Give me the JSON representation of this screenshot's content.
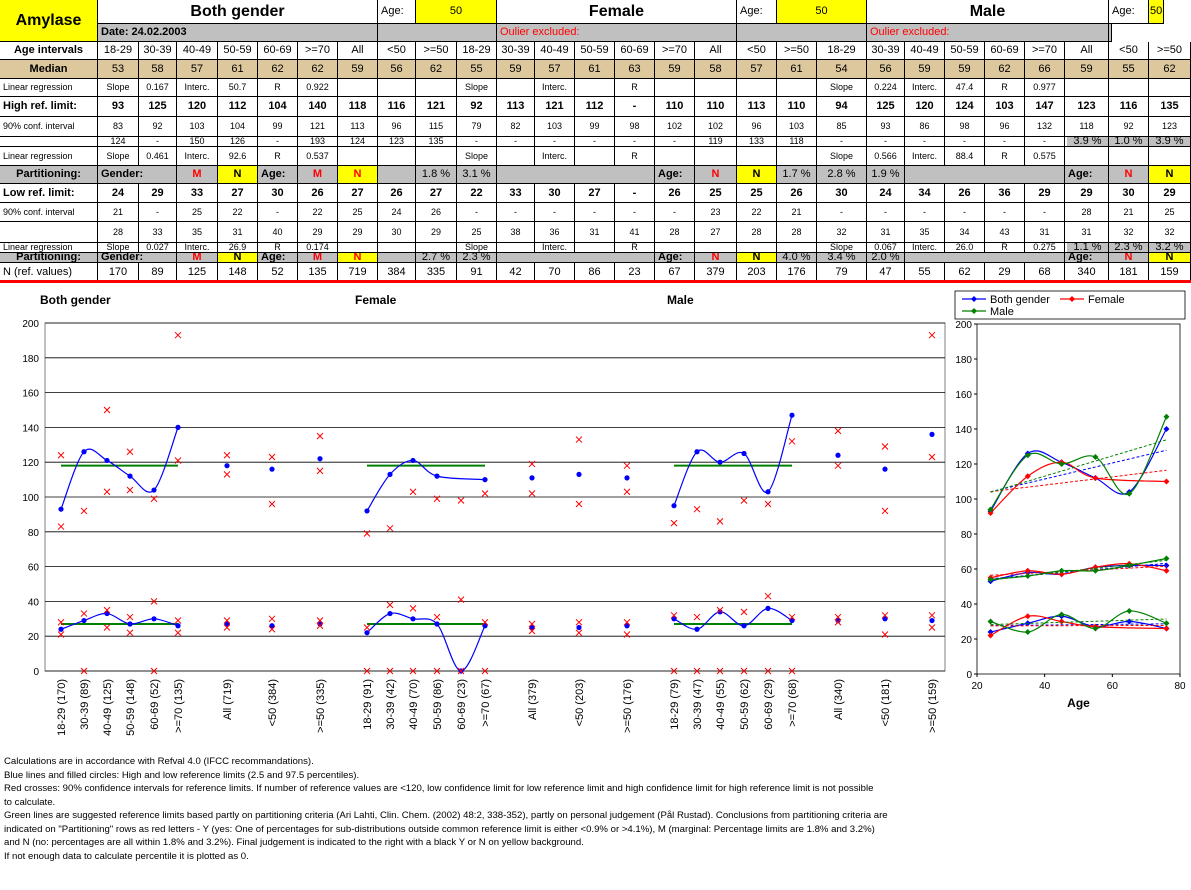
{
  "title": "Amylase",
  "date": "Date: 24.02.2003",
  "groups": {
    "both": "Both gender",
    "female": "Female",
    "male": "Male"
  },
  "age_label": "Age:",
  "age_value": "50",
  "outlier_note": "Oulier excluded:",
  "age_intervals_label": "Age intervals",
  "col_labels": [
    "18-29",
    "30-39",
    "40-49",
    "50-59",
    "60-69",
    ">=70",
    "All",
    "<50",
    ">=50"
  ],
  "rows": {
    "median": {
      "label": "Median",
      "both": [
        "53",
        "58",
        "57",
        "61",
        "62",
        "62",
        "59",
        "56",
        "62"
      ],
      "female": [
        "55",
        "59",
        "57",
        "61",
        "63",
        "59",
        "58",
        "57",
        "61"
      ],
      "male": [
        "54",
        "56",
        "59",
        "59",
        "62",
        "66",
        "59",
        "55",
        "62"
      ]
    },
    "linreg_top": {
      "label": "Linear regression",
      "both": [
        "Slope",
        "0.167",
        "Interc.",
        "50.7",
        "R",
        "0.922",
        "",
        "",
        ""
      ],
      "female": [
        "Slope",
        "",
        "Interc.",
        "",
        "R",
        "",
        "",
        "",
        ""
      ],
      "male": [
        "Slope",
        "0.224",
        "Interc.",
        "47.4",
        "R",
        "0.977",
        "",
        "",
        ""
      ]
    },
    "high": {
      "label": "High ref. limit:",
      "both": [
        "93",
        "125",
        "120",
        "112",
        "104",
        "140",
        "118",
        "116",
        "121"
      ],
      "female": [
        "92",
        "113",
        "121",
        "112",
        "-",
        "110",
        "110",
        "113",
        "110"
      ],
      "male": [
        "94",
        "125",
        "120",
        "124",
        "103",
        "147",
        "123",
        "116",
        "135"
      ]
    },
    "hci1": {
      "label": "90% conf. interval",
      "both": [
        "83",
        "92",
        "103",
        "104",
        "99",
        "121",
        "113",
        "96",
        "115"
      ],
      "female": [
        "79",
        "82",
        "103",
        "99",
        "98",
        "102",
        "102",
        "96",
        "103"
      ],
      "male": [
        "85",
        "93",
        "86",
        "98",
        "96",
        "132",
        "118",
        "92",
        "123"
      ]
    },
    "hci2": {
      "both": [
        "124",
        "-",
        "150",
        "126",
        "-",
        "193",
        "124",
        "123",
        "135"
      ],
      "female": [
        "-",
        "-",
        "-",
        "-",
        "-",
        "-",
        "119",
        "133",
        "118"
      ],
      "male": [
        "-",
        "-",
        "-",
        "-",
        "-",
        "-",
        "138",
        "129",
        "193"
      ]
    },
    "linreg_high": {
      "label": "Linear regression",
      "both": [
        "Slope",
        "0.461",
        "Interc.",
        "92.6",
        "R",
        "0.537",
        "",
        "",
        ""
      ],
      "female": [
        "Slope",
        "",
        "Interc.",
        "",
        "R",
        "",
        "",
        "",
        ""
      ],
      "male": [
        "Slope",
        "0.566",
        "Interc.",
        "88.4",
        "R",
        "0.575",
        "",
        "",
        ""
      ]
    },
    "part1": {
      "label": "Partitioning:",
      "gender": "Gender:",
      "gender_val": "M",
      "n": "N",
      "age": "Age:",
      "age_val": "M",
      "age_n": "N",
      "both_pct": [
        "1.8 %",
        "3.1 %"
      ],
      "female_pct": [
        "1.7 %",
        "2.8 %",
        "1.9 %"
      ],
      "female_n": "N",
      "male_n1": "N",
      "male_pct": [
        "3.9 %",
        "1.0 %",
        "3.9 %"
      ]
    },
    "low": {
      "label": "Low ref. limit:",
      "both": [
        "24",
        "29",
        "33",
        "27",
        "30",
        "26",
        "27",
        "26",
        "27"
      ],
      "female": [
        "22",
        "33",
        "30",
        "27",
        "-",
        "26",
        "25",
        "25",
        "26"
      ],
      "male": [
        "30",
        "24",
        "34",
        "26",
        "36",
        "29",
        "29",
        "30",
        "29"
      ]
    },
    "lci1": {
      "label": "90% conf. interval",
      "both": [
        "21",
        "-",
        "25",
        "22",
        "-",
        "22",
        "25",
        "24",
        "26"
      ],
      "female": [
        "-",
        "-",
        "-",
        "-",
        "-",
        "-",
        "23",
        "22",
        "21"
      ],
      "male": [
        "-",
        "-",
        "-",
        "-",
        "-",
        "-",
        "28",
        "21",
        "25"
      ]
    },
    "lci2": {
      "both": [
        "28",
        "33",
        "35",
        "31",
        "40",
        "29",
        "29",
        "30",
        "29"
      ],
      "female": [
        "25",
        "38",
        "36",
        "31",
        "41",
        "28",
        "27",
        "28",
        "28"
      ],
      "male": [
        "32",
        "31",
        "35",
        "34",
        "43",
        "31",
        "31",
        "32",
        "32"
      ]
    },
    "linreg_low": {
      "label": "Linear regression",
      "both": [
        "Slope",
        "0.027",
        "Interc.",
        "26.9",
        "R",
        "0.174",
        "",
        "",
        ""
      ],
      "female": [
        "Slope",
        "",
        "Interc.",
        "",
        "R",
        "",
        "",
        "",
        ""
      ],
      "male": [
        "Slope",
        "0.067",
        "Interc.",
        "26.0",
        "R",
        "0.275",
        "",
        "",
        ""
      ]
    },
    "part2": {
      "label": "Partitioning:",
      "gender": "Gender:",
      "gender_val": "M",
      "n": "N",
      "age": "Age:",
      "age_val": "M",
      "age_n": "N",
      "both_pct": [
        "2.7 %",
        "2.3 %"
      ],
      "female_pct": [
        "4.0 %",
        "3.4 %",
        "2.0 %"
      ],
      "female_n": "N",
      "male_n1": "N",
      "male_pct": [
        "1.1 %",
        "2.3 %",
        "3.2 %"
      ]
    },
    "nref": {
      "label": "N (ref. values)",
      "both": [
        "170",
        "89",
        "125",
        "148",
        "52",
        "135",
        "719",
        "384",
        "335"
      ],
      "female": [
        "91",
        "42",
        "70",
        "86",
        "23",
        "67",
        "379",
        "203",
        "176"
      ],
      "male": [
        "79",
        "47",
        "55",
        "62",
        "29",
        "68",
        "340",
        "181",
        "159"
      ]
    }
  },
  "charts": {
    "titles": [
      "Both gender",
      "Female",
      "Male"
    ],
    "y_ticks": [
      "0",
      "20",
      "40",
      "60",
      "80",
      "100",
      "120",
      "140",
      "160",
      "180",
      "200"
    ],
    "x_labels": [
      "18-29 (170)",
      "30-39 (89)",
      "40-49 (125)",
      "50-59 (148)",
      "60-69 (52)",
      ">=70 (135)",
      "All (719)",
      "<50 (384)",
      ">=50 (335)",
      "18-29 (91)",
      "30-39 (42)",
      "40-49 (70)",
      "50-59 (86)",
      "60-69 (23)",
      ">=70 (67)",
      "All (379)",
      "<50 (203)",
      ">=50 (176)",
      "18-29 (79)",
      "30-39 (47)",
      "40-49 (55)",
      "50-59 (62)",
      "60-69 (29)",
      ">=70 (68)",
      "All (340)",
      "<50 (181)",
      ">=50 (159)"
    ],
    "side_x_ticks": [
      "20",
      "40",
      "60",
      "80"
    ],
    "side_x_title": "Age",
    "legend": [
      "Both gender",
      "Female",
      "Male"
    ]
  },
  "chart_data": [
    {
      "type": "scatter",
      "title": "",
      "categories": [
        "18-29 (170)",
        "30-39 (89)",
        "40-49 (125)",
        "50-59 (148)",
        "60-69 (52)",
        ">=70 (135)",
        "All (719)",
        "<50 (384)",
        ">=50 (335)",
        "18-29 (91)",
        "30-39 (42)",
        "40-49 (70)",
        "50-59 (86)",
        "60-69 (23)",
        ">=70 (67)",
        "All (379)",
        "<50 (203)",
        ">=50 (176)",
        "18-29 (79)",
        "30-39 (47)",
        "40-49 (55)",
        "50-59 (62)",
        "60-69 (29)",
        ">=70 (68)",
        "All (340)",
        "<50 (181)",
        ">=50 (159)"
      ],
      "ylim": [
        0,
        200
      ],
      "series": [
        {
          "name": "High ref. limit",
          "values": [
            93,
            126,
            121,
            112,
            104,
            140,
            118,
            116,
            122,
            92,
            113,
            121,
            112,
            null,
            110,
            111,
            113,
            111,
            95,
            126,
            120,
            125,
            103,
            147,
            124,
            116,
            136
          ]
        },
        {
          "name": "Low ref. limit",
          "values": [
            24,
            29,
            33,
            27,
            30,
            26,
            27,
            26,
            27,
            22,
            33,
            30,
            27,
            0,
            26,
            25,
            25,
            26,
            30,
            24,
            34,
            26,
            36,
            29,
            29,
            30,
            29
          ]
        },
        {
          "name": "High CI low",
          "values": [
            83,
            92,
            103,
            104,
            99,
            121,
            113,
            96,
            115,
            79,
            82,
            103,
            99,
            98,
            102,
            102,
            96,
            103,
            85,
            93,
            86,
            98,
            96,
            132,
            118,
            92,
            123
          ]
        },
        {
          "name": "High CI high",
          "values": [
            124,
            null,
            150,
            126,
            null,
            193,
            124,
            123,
            135,
            null,
            null,
            null,
            null,
            null,
            null,
            119,
            133,
            118,
            null,
            null,
            null,
            null,
            null,
            null,
            138,
            129,
            193
          ]
        },
        {
          "name": "Low CI low",
          "values": [
            21,
            0,
            25,
            22,
            0,
            22,
            25,
            24,
            26,
            0,
            0,
            0,
            0,
            0,
            0,
            23,
            22,
            21,
            0,
            0,
            0,
            0,
            0,
            0,
            28,
            21,
            25
          ]
        },
        {
          "name": "Low CI high",
          "values": [
            28,
            33,
            35,
            31,
            40,
            29,
            29,
            30,
            29,
            25,
            38,
            36,
            31,
            41,
            28,
            27,
            28,
            28,
            32,
            31,
            35,
            34,
            43,
            31,
            31,
            32,
            32
          ]
        }
      ]
    },
    {
      "type": "line",
      "title": "",
      "xlabel": "Age",
      "xlim": [
        20,
        80
      ],
      "ylim": [
        0,
        200
      ],
      "x": [
        24,
        35,
        45,
        55,
        65,
        76
      ],
      "series": [
        {
          "name": "Both gender",
          "values": [
            93,
            126,
            121,
            112,
            104,
            140
          ]
        },
        {
          "name": "Female",
          "values": [
            92,
            113,
            121,
            112,
            null,
            110
          ]
        },
        {
          "name": "Male",
          "values": [
            94,
            125,
            120,
            124,
            103,
            147
          ]
        },
        {
          "name": "Both gender",
          "values": [
            53,
            58,
            57,
            61,
            62,
            62
          ]
        },
        {
          "name": "Female",
          "values": [
            55,
            59,
            57,
            61,
            63,
            59
          ]
        },
        {
          "name": "Male",
          "values": [
            54,
            56,
            59,
            59,
            62,
            66
          ]
        },
        {
          "name": "Both gender",
          "values": [
            24,
            29,
            33,
            27,
            30,
            26
          ]
        },
        {
          "name": "Female",
          "values": [
            22,
            33,
            30,
            27,
            null,
            26
          ]
        },
        {
          "name": "Male",
          "values": [
            30,
            24,
            34,
            26,
            36,
            29
          ]
        }
      ]
    }
  ],
  "notes": [
    "Calculations are in accordance with Refval 4.0 (IFCC recommandations).",
    "Blue lines and filled circles: High and low reference limits (2.5 and 97.5 percentiles).",
    "Red crosses: 90% confidence intervals for reference limits. If number of reference values are <120, low confidence limit for low reference limit and high confidence limit for high reference limit is not possible",
    "to calculate.",
    "Green lines are suggested reference limits based partly on partitioning criteria (Ari Lahti, Clin. Chem. (2002) 48:2, 338-352), partly on personal judgement (Pål Rustad). Conclusions from partitioning criteria are",
    "indicated on \"Partitioning\" rows as red letters - Y (yes: One of percentages for sub-distributions outside common reference limit is either <0.9% or >4.1%), M (marginal: Percentage limits are 1.8% and 3.2%)",
    "and N (no:  percentages are all within 1.8% and 3.2%). Final judgement is indicated to the right with a black Y or N on yellow background.",
    "If not enough data to calculate percentile it is plotted as 0."
  ],
  "colors": {
    "blue": "#0000ff",
    "red": "#ff0000",
    "green": "#008000",
    "yellow": "#ffff00",
    "gray": "#c0c0c0",
    "tan": "#ddc79d"
  }
}
